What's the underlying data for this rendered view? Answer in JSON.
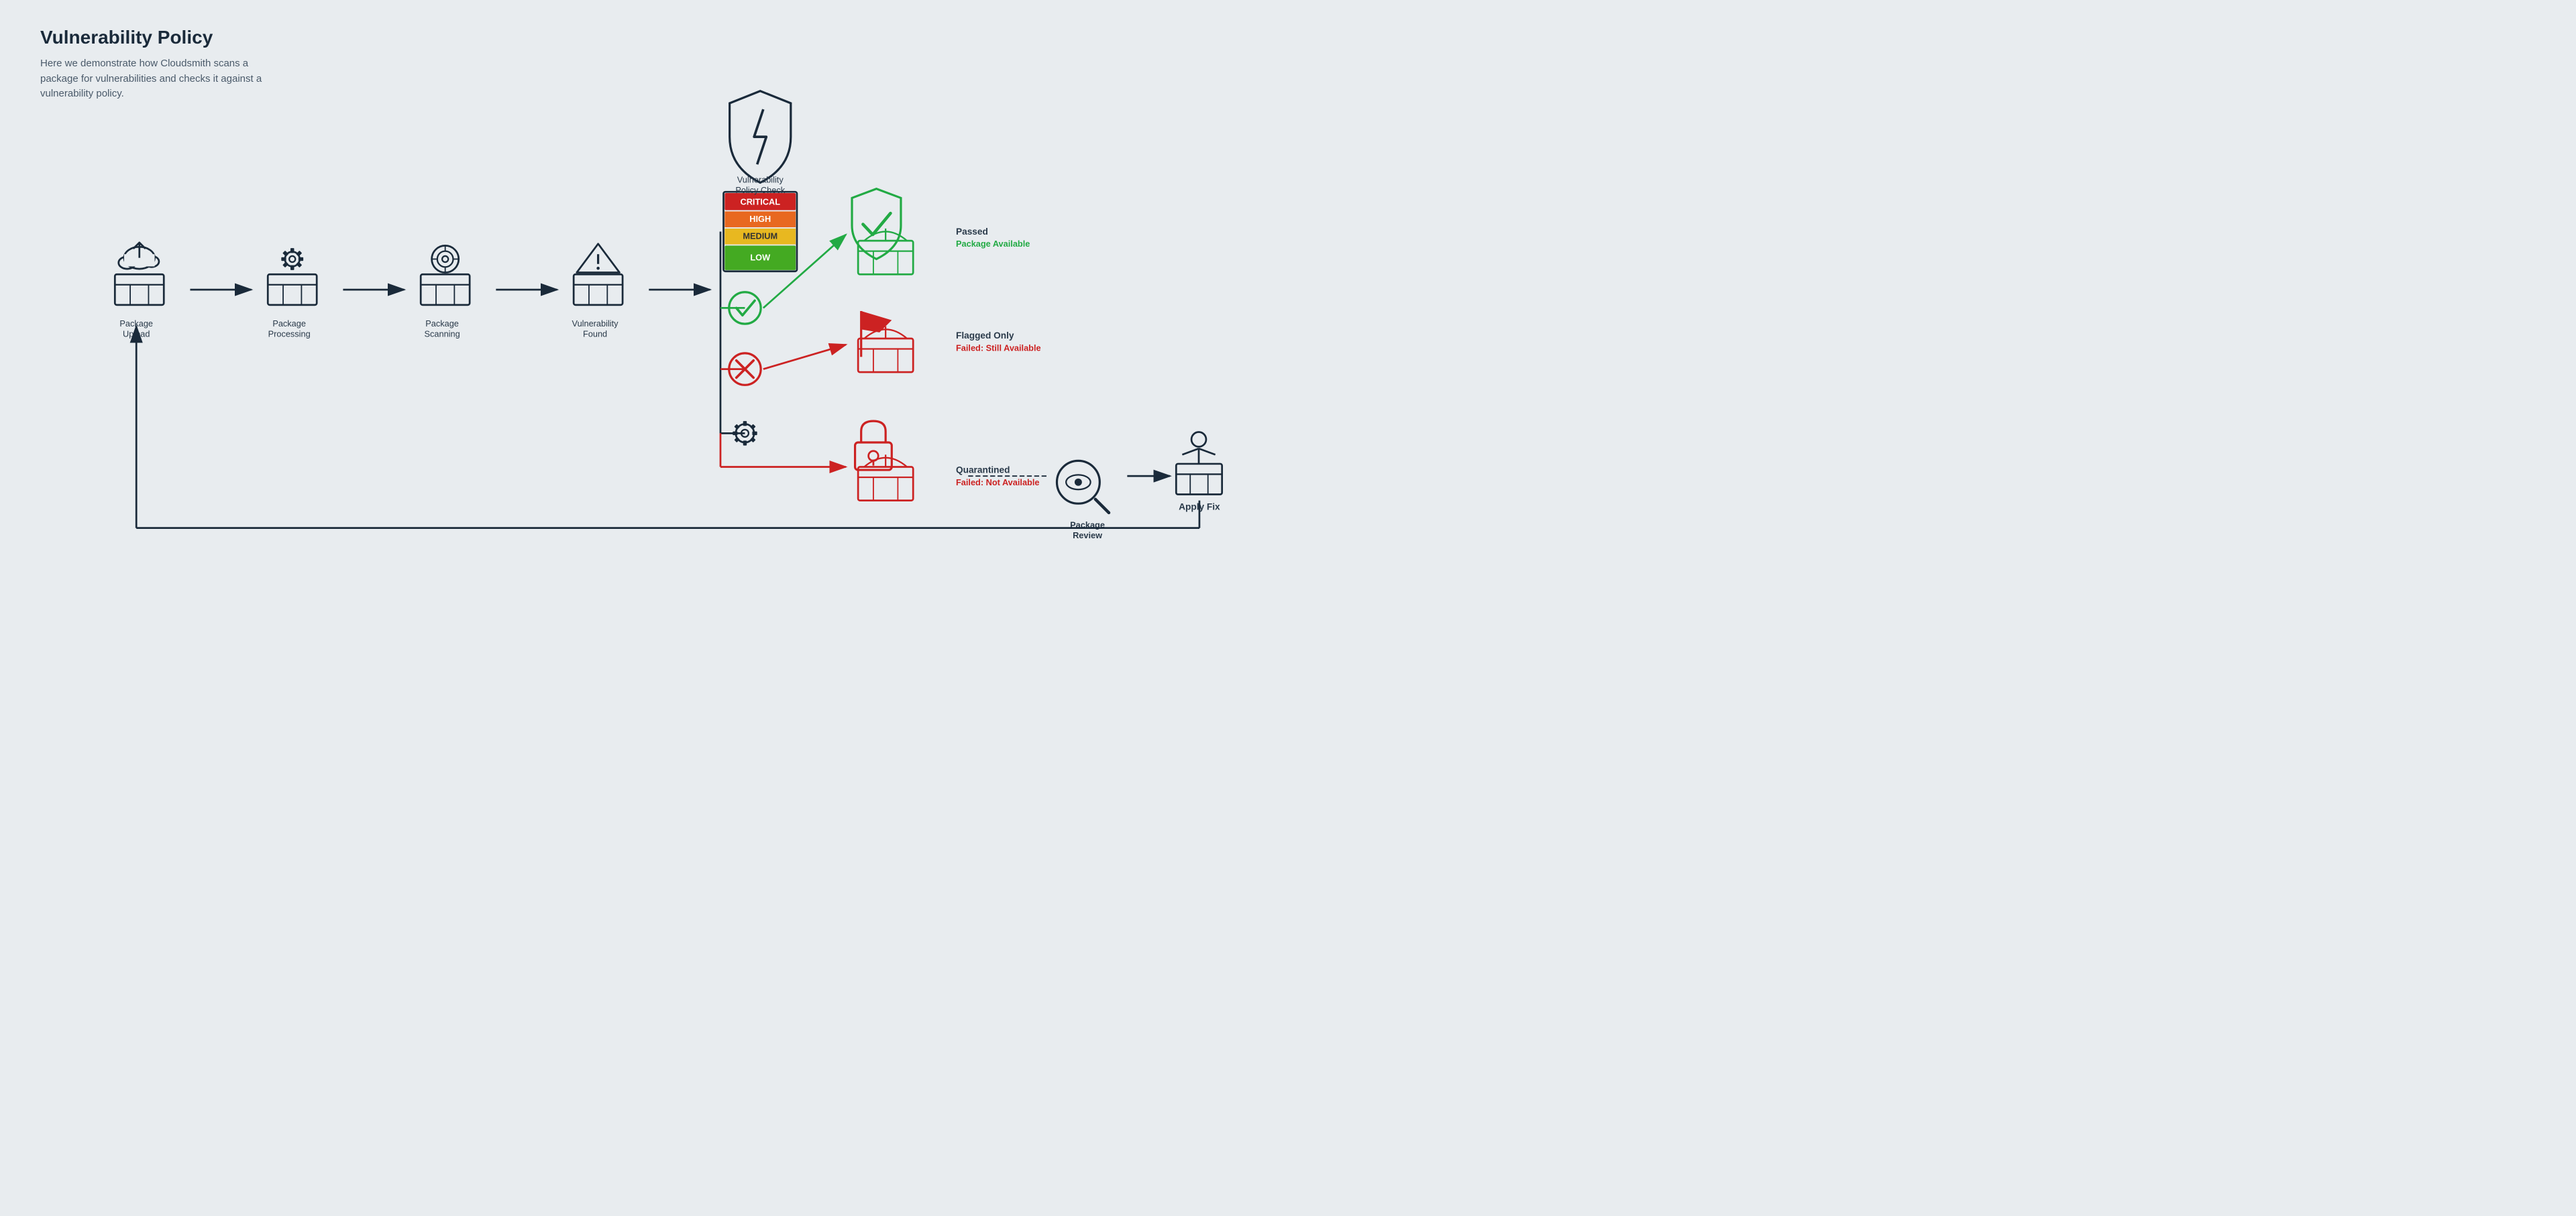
{
  "page": {
    "title": "Vulnerability Policy",
    "subtitle": "Here we demonstrate how Cloudsmith scans a package for vulnerabilities and checks it against a vulnerability policy.",
    "bg_color": "#e8ecef"
  },
  "flow": {
    "steps": [
      {
        "id": "upload",
        "label": "Package\nUpload"
      },
      {
        "id": "processing",
        "label": "Package\nProcessing"
      },
      {
        "id": "scanning",
        "label": "Package\nScanning"
      },
      {
        "id": "vuln_found",
        "label": "Vulnerability\nFound"
      }
    ],
    "policy_check": {
      "label": "Vulnerability\nPolicy Check",
      "severities": [
        {
          "name": "CRITICAL",
          "color": "#cc2222"
        },
        {
          "name": "HIGH",
          "color": "#e86820"
        },
        {
          "name": "MEDIUM",
          "color": "#e8b820"
        },
        {
          "name": "LOW",
          "color": "#44aa22"
        }
      ]
    },
    "outcomes": [
      {
        "id": "passed",
        "title": "Passed",
        "subtitle": "Package Available",
        "color": "#22aa44"
      },
      {
        "id": "flagged",
        "title": "Flagged Only",
        "subtitle": "Failed: Still Available",
        "color": "#cc2222"
      },
      {
        "id": "quarantined",
        "title": "Quarantined",
        "subtitle": "Failed: Not Available",
        "color": "#cc2222"
      },
      {
        "id": "review",
        "title": "Package\nReview",
        "color": "#1a2a3a"
      },
      {
        "id": "apply_fix",
        "title": "Apply Fix",
        "color": "#1a2a3a"
      }
    ]
  }
}
